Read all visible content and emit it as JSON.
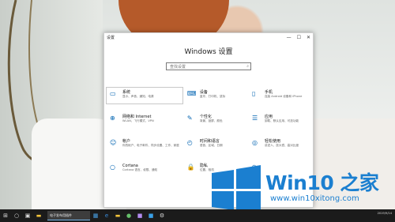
{
  "window": {
    "title": "设置",
    "heading": "Windows 设置",
    "search_placeholder": "查找设置",
    "controls": {
      "minimize": "—",
      "maximize": "☐",
      "close": "✕"
    }
  },
  "settings_items": [
    {
      "icon": "laptop-icon",
      "glyph": "▭",
      "title": "系统",
      "desc": "显示、声音、通知、电源"
    },
    {
      "icon": "keyboard-icon",
      "glyph": "⌨",
      "title": "设备",
      "desc": "蓝牙、打印机、鼠标"
    },
    {
      "icon": "phone-icon",
      "glyph": "▯",
      "title": "手机",
      "desc": "连接 Android 设备和 iPhone"
    },
    {
      "icon": "globe-icon",
      "glyph": "⊕",
      "title": "网络和 Internet",
      "desc": "WLAN、飞行模式、VPN"
    },
    {
      "icon": "brush-icon",
      "glyph": "✎",
      "title": "个性化",
      "desc": "背景、锁屏、颜色"
    },
    {
      "icon": "apps-icon",
      "glyph": "☰",
      "title": "应用",
      "desc": "卸载、默认应用、可选功能"
    },
    {
      "icon": "person-icon",
      "glyph": "☺",
      "title": "帐户",
      "desc": "你的帐户、电子邮件、同步设置、工作、家庭"
    },
    {
      "icon": "clock-language-icon",
      "glyph": "◴",
      "title": "时间和语言",
      "desc": "语音、区域、日期"
    },
    {
      "icon": "gamepad-icon",
      "glyph": "◎",
      "title": "轻松使用",
      "desc": "讲述人、放大镜、高对比度"
    },
    {
      "icon": "cortana-icon",
      "glyph": "○",
      "title": "Cortana",
      "desc": "Cortana 语言、权限、通知"
    },
    {
      "icon": "lock-icon",
      "glyph": "🔒",
      "title": "隐私",
      "desc": "位置、相机"
    },
    {
      "icon": "update-icon",
      "glyph": "⟳",
      "title": "",
      "desc": ""
    }
  ],
  "taskbar": {
    "task_label": "电子发布用插件",
    "clock_time": "",
    "clock_date": "2019/9/14"
  },
  "watermark": {
    "brand": "Win10 之家",
    "site": "www.win10xitong.com",
    "colors": {
      "blue": "#1b7fd0"
    }
  }
}
